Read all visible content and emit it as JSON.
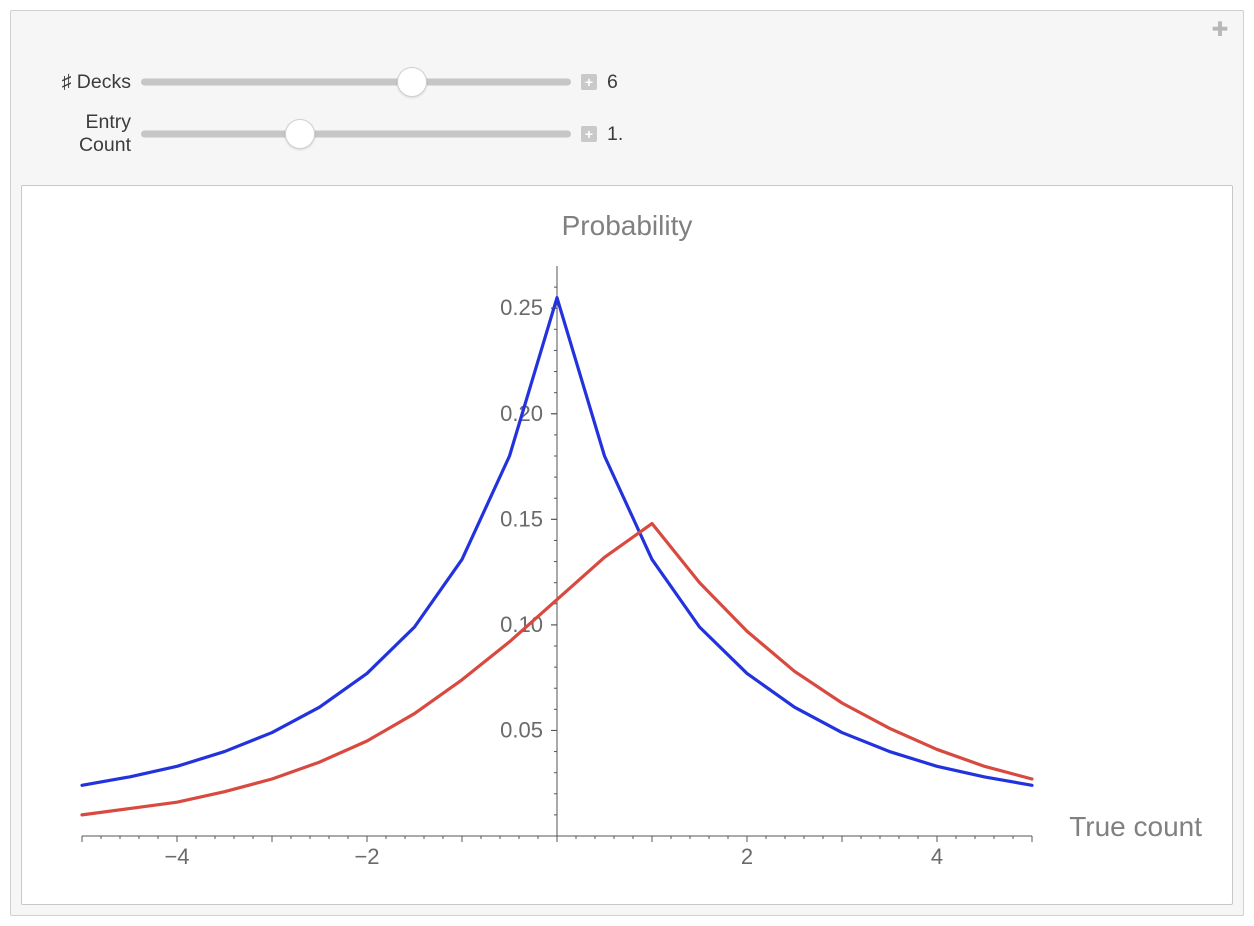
{
  "controls": {
    "decks": {
      "label": "♯ Decks",
      "value": "6",
      "position_pct": 63
    },
    "entry": {
      "label": "Entry Count",
      "value": "1.",
      "position_pct": 37
    }
  },
  "icons": {
    "corner": "✚",
    "mini": "+"
  },
  "chart_data": {
    "type": "line",
    "title": "Probability",
    "xlabel": "True count",
    "ylabel": "",
    "xlim": [
      -5,
      5
    ],
    "ylim": [
      0,
      0.27
    ],
    "yticks": [
      0.05,
      0.1,
      0.15,
      0.2,
      0.25
    ],
    "xticks": [
      -4,
      -2,
      2,
      4
    ],
    "series": [
      {
        "name": "blue",
        "color": "#2233dd",
        "x": [
          -5.0,
          -4.5,
          -4.0,
          -3.5,
          -3.0,
          -2.5,
          -2.0,
          -1.5,
          -1.0,
          -0.5,
          0.0,
          0.5,
          1.0,
          1.5,
          2.0,
          2.5,
          3.0,
          3.5,
          4.0,
          4.5,
          5.0
        ],
        "values": [
          0.024,
          0.028,
          0.033,
          0.04,
          0.049,
          0.061,
          0.077,
          0.099,
          0.131,
          0.18,
          0.255,
          0.18,
          0.131,
          0.099,
          0.077,
          0.061,
          0.049,
          0.04,
          0.033,
          0.028,
          0.024
        ]
      },
      {
        "name": "red",
        "color": "#d84a3f",
        "x": [
          -5.0,
          -4.5,
          -4.0,
          -3.5,
          -3.0,
          -2.5,
          -2.0,
          -1.5,
          -1.0,
          -0.5,
          0.0,
          0.5,
          1.0,
          1.5,
          2.0,
          2.5,
          3.0,
          3.5,
          4.0,
          4.5,
          5.0
        ],
        "values": [
          0.01,
          0.013,
          0.016,
          0.021,
          0.027,
          0.035,
          0.045,
          0.058,
          0.074,
          0.092,
          0.112,
          0.132,
          0.148,
          0.12,
          0.097,
          0.078,
          0.063,
          0.051,
          0.041,
          0.033,
          0.027
        ]
      }
    ]
  }
}
